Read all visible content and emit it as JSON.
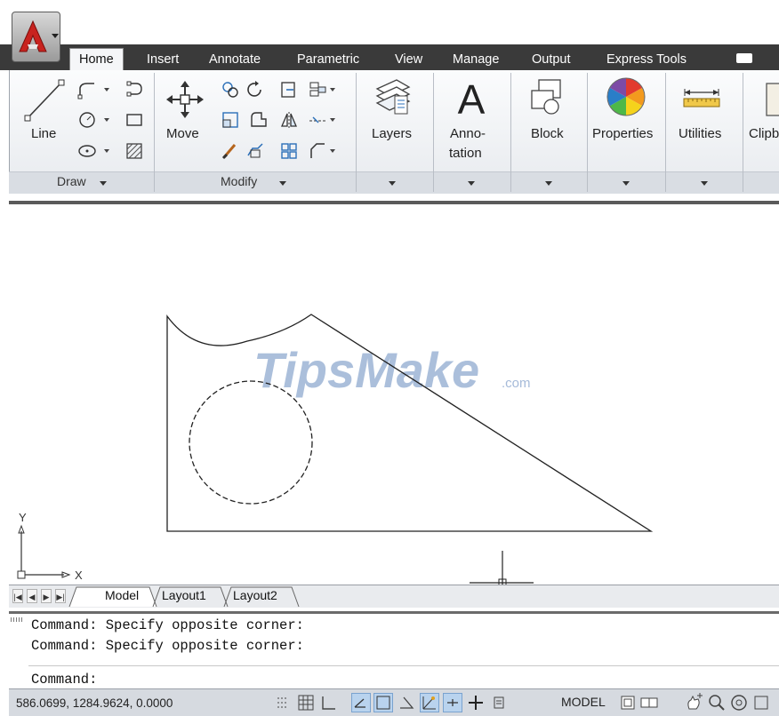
{
  "ribbon": {
    "tabs": [
      "Home",
      "Insert",
      "Annotate",
      "Parametric",
      "View",
      "Manage",
      "Output",
      "Express Tools"
    ],
    "active_tab": "Home",
    "draw_panel": {
      "title": "Draw",
      "line_label": "Line"
    },
    "modify_panel": {
      "title": "Modify",
      "move_label": "Move"
    },
    "layers_label": "Layers",
    "annotation_label_1": "Anno-",
    "annotation_label_2": "tation",
    "block_label": "Block",
    "properties_label": "Properties",
    "utilities_label": "Utilities",
    "clipboard_label": "Clipb"
  },
  "canvas": {
    "watermark_main": "TipsMake",
    "watermark_suffix": ".com",
    "ucs_x": "X",
    "ucs_y": "Y"
  },
  "layout_tabs": [
    "Model",
    "Layout1",
    "Layout2"
  ],
  "command": {
    "history": [
      "Command: Specify opposite corner:",
      "Command: Specify opposite corner:"
    ],
    "prompt": "Command:"
  },
  "status_bar": {
    "coordinates": "586.0699, 1284.9624, 0.0000",
    "space": "MODEL"
  },
  "colors": {
    "tab_bar": "#3a3a3a",
    "watermark": "#8fa9cf",
    "app_red": "#c8231f"
  },
  "icons": [
    "app-menu-icon",
    "line-icon",
    "polyline-icon",
    "circle-icon",
    "arc-icon",
    "rectangle-icon",
    "ellipse-icon",
    "hatch-icon",
    "move-icon",
    "rotate-icon",
    "trim-icon",
    "copy-icon",
    "mirror-icon",
    "fillet-icon",
    "stretch-icon",
    "scale-icon",
    "array-icon",
    "erase-icon",
    "explode-icon",
    "offset-icon",
    "layers-icon",
    "annotation-icon",
    "block-icon",
    "properties-icon",
    "utilities-icon",
    "clipboard-icon",
    "ucs-icon",
    "crosshair-icon"
  ]
}
